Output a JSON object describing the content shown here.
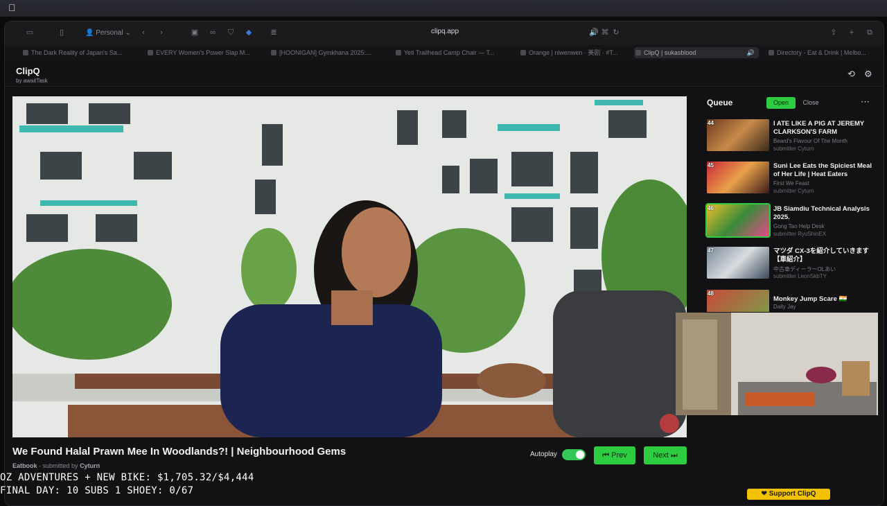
{
  "browser": {
    "profile": "Personal",
    "url": "clipq.app",
    "tabs": [
      {
        "label": "The Dark Reality of Japan's Sa..."
      },
      {
        "label": "EVERY Women's Power Slap M..."
      },
      {
        "label": "[HOONIGAN] Gymkhana 2025:..."
      },
      {
        "label": "Yeti Trailhead Camp Chair — T..."
      },
      {
        "label": "Orange | niwenwen · 美剧 · #T..."
      },
      {
        "label": "ClipQ | sukasblood"
      },
      {
        "label": "Directory - Eat & Drink | Melbo..."
      }
    ]
  },
  "app": {
    "name": "ClipQ",
    "by": "by awaitTask"
  },
  "video": {
    "title": "We Found Halal Prawn Mee In Woodlands?! | Neighbourhood Gems",
    "channel": "Eatbook",
    "submitted_prefix": "- submitted by",
    "submitter": "Cyturn",
    "autoplay_label": "Autoplay",
    "autoplay_on": true,
    "prev_label": "⏮ Prev",
    "next_label": "Next ⏭"
  },
  "queue": {
    "title": "Queue",
    "open_label": "Open",
    "close_label": "Close",
    "more_icon": "ellipsis-icon",
    "items": [
      {
        "num": "44",
        "title": "I ATE LIKE A PIG AT JEREMY CLARKSON'S FARM",
        "channel": "Beard's Flavour Of The Month",
        "submitter": "submitter Cyturn"
      },
      {
        "num": "45",
        "title": "Suni Lee Eats the Spiciest Meal of Her Life | Heat Eaters",
        "channel": "First We Feast",
        "submitter": "submitter Cyturn"
      },
      {
        "num": "46",
        "title": "JB Siamdiu Technical Analysis 2025.",
        "channel": "Gong Tao Help Desk",
        "submitter": "submitter RyuShinEX"
      },
      {
        "num": "47",
        "title": "マツダ CX-3を紹介していきます【車紹介】",
        "channel": "中古車ディーラーOLあい",
        "submitter": "submitter LeonSkbTY"
      },
      {
        "num": "48",
        "title": "Monkey Jump Scare 🇮🇳",
        "channel": "Daily Jay",
        "submitter": ""
      }
    ]
  },
  "overlay": {
    "line1": "OZ ADVENTURES + NEW BIKE: $1,705.32/$4,444",
    "line2": "FINAL DAY: 10 SUBS 1 SHOEY: 0/67"
  },
  "support_label": "Support ClipQ",
  "colors": {
    "accent_green": "#2ecc40",
    "background": "#121214",
    "support_yellow": "#f2c200"
  }
}
